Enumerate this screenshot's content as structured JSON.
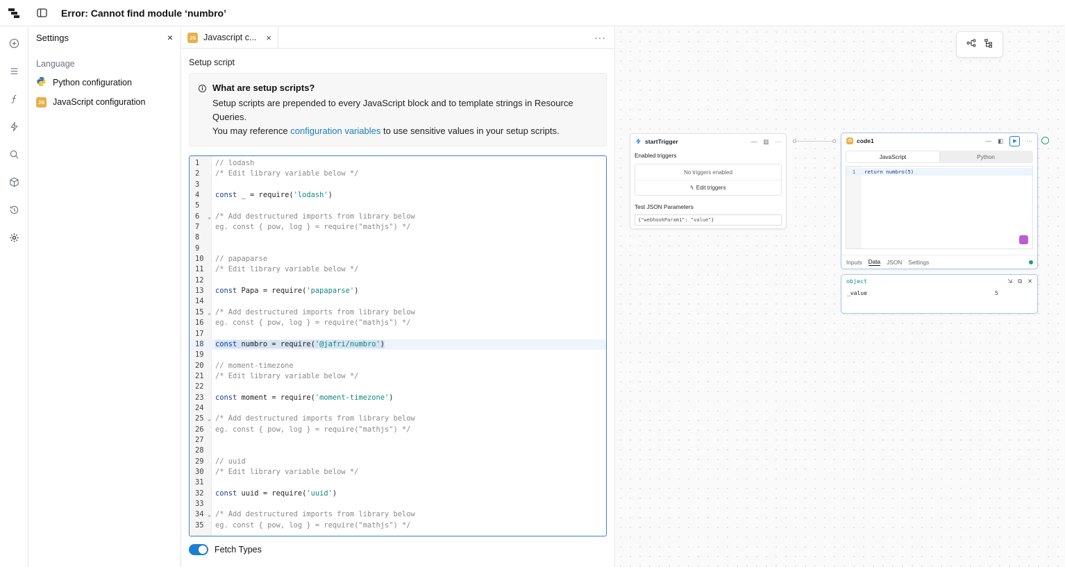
{
  "header": {
    "title": "Error: Cannot find module ‘numbro’"
  },
  "rail": [
    "plus-circle-icon",
    "list-icon",
    "function-icon",
    "lightning-icon",
    "search-icon",
    "package-icon",
    "history-icon",
    "gear-icon"
  ],
  "settings": {
    "title": "Settings",
    "close": "×",
    "section": "Language",
    "items": [
      {
        "label": "Python configuration",
        "icon": "python-icon"
      },
      {
        "label": "JavaScript configuration",
        "icon": "js-icon",
        "badge": "JS"
      }
    ]
  },
  "editor": {
    "tab_label": "Javascript c...",
    "tab_badge": "JS",
    "tab_close": "×",
    "more": "···",
    "setup_title": "Setup script",
    "info": {
      "title": "What are setup scripts?",
      "line1": "Setup scripts are prepended to every JavaScript block and to template strings in Resource Queries.",
      "line2_pre": "You may reference ",
      "line2_link": "configuration variables",
      "line2_post": " to use sensitive values in your setup scripts."
    },
    "code_lines": [
      "// lodash",
      "/* Edit library variable below */",
      "",
      "const _ = require('lodash')",
      "",
      "/* Add destructured imports from library below",
      "eg. const { pow, log } = require(\"mathjs\") */",
      "",
      "",
      "// papaparse",
      "/* Edit library variable below */",
      "",
      "const Papa = require('papaparse')",
      "",
      "/* Add destructured imports from library below",
      "eg. const { pow, log } = require(\"mathjs\") */",
      "",
      "const numbro = require('@jafri/numbro')",
      "",
      "// moment-timezone",
      "/* Edit library variable below */",
      "",
      "const moment = require('moment-timezone')",
      "",
      "/* Add destructured imports from library below",
      "eg. const { pow, log } = require(\"mathjs\") */",
      "",
      "",
      "// uuid",
      "/* Edit library variable below */",
      "",
      "const uuid = require('uuid')",
      "",
      "/* Add destructured imports from library below",
      "eg. const { pow, log } = require(\"mathjs\") */"
    ],
    "fold_lines": [
      6,
      15,
      25,
      34
    ],
    "active_line": 18,
    "fetch_types_label": "Fetch Types",
    "fetch_types_on": true
  },
  "canvas": {
    "trigger": {
      "title": "startTrigger",
      "enabled_label": "Enabled triggers",
      "no_triggers": "No triggers enabled",
      "edit_triggers": "Edit triggers",
      "test_label": "Test JSON Parameters",
      "test_value": "{\"webhookParam1\": \"value\"}"
    },
    "code_node": {
      "title": "code1",
      "badge": "JS",
      "lang_js": "JavaScript",
      "lang_py": "Python",
      "line_no": "1",
      "code": "return numbro(5)",
      "tabs": [
        "Inputs",
        "Data",
        "JSON",
        "Settings"
      ],
      "active_tab": "Data"
    },
    "output": {
      "type": "object",
      "key": "_value",
      "value": "5"
    }
  },
  "colors": {
    "accent": "#1a7fd0",
    "js": "#e8b04a",
    "success": "#1da06a"
  }
}
